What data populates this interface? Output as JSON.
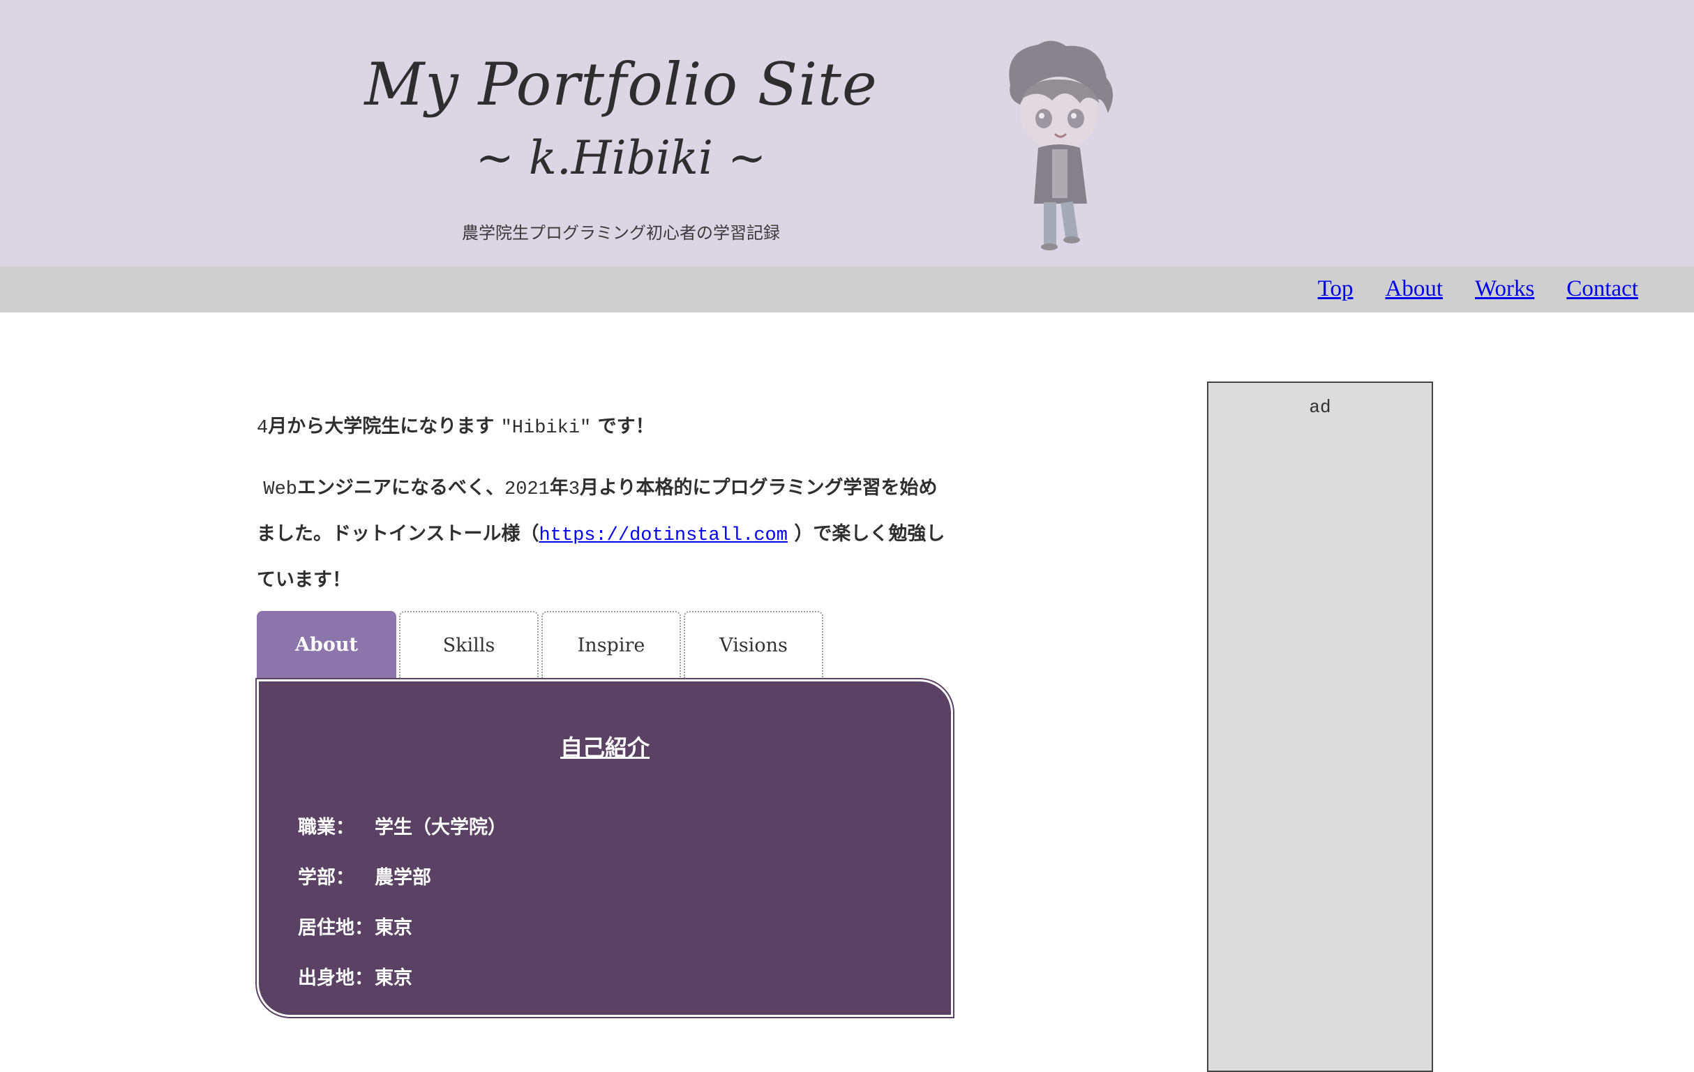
{
  "header": {
    "title": "My Portfolio Site",
    "subtitle": "~ k.Hibiki ~",
    "tagline": "農学院生プログラミング初心者の学習記録"
  },
  "nav": {
    "items": [
      {
        "label": "Top"
      },
      {
        "label": "About"
      },
      {
        "label": "Works"
      },
      {
        "label": "Contact"
      }
    ]
  },
  "intro": {
    "line1_a": "4",
    "line1_b": "月から大学院生になります",
    "line1_c": "\"Hibiki\"",
    "line1_d": "です！",
    "line2_a": "Web",
    "line2_b": "エンジニアになるべく、",
    "line2_c": "2021",
    "line2_d": "年",
    "line2_e": "3",
    "line2_f": "月より本格的にプログラミング学習を始めました。ドットインストール様（",
    "link": "https://dotinstall.com",
    "line2_g": "）で楽しく勉強しています！"
  },
  "tabs": [
    {
      "label": "About"
    },
    {
      "label": "Skills"
    },
    {
      "label": "Inspire"
    },
    {
      "label": "Visions"
    }
  ],
  "panel": {
    "title": "自己紹介",
    "rows": [
      {
        "label": "職業：",
        "value": "学生（大学院）"
      },
      {
        "label": "学部：",
        "value": "農学部"
      },
      {
        "label": "居住地：",
        "value": "東京"
      },
      {
        "label": "出身地：",
        "value": "東京"
      }
    ]
  },
  "sidebar": {
    "ad_label": "ad"
  },
  "colors": {
    "header_bg": "#dbd6e3",
    "nav_bg": "#cfcfcf",
    "tab_active": "#8b75ab",
    "panel_bg": "#5b4164",
    "ad_bg": "#dcdcdc"
  }
}
